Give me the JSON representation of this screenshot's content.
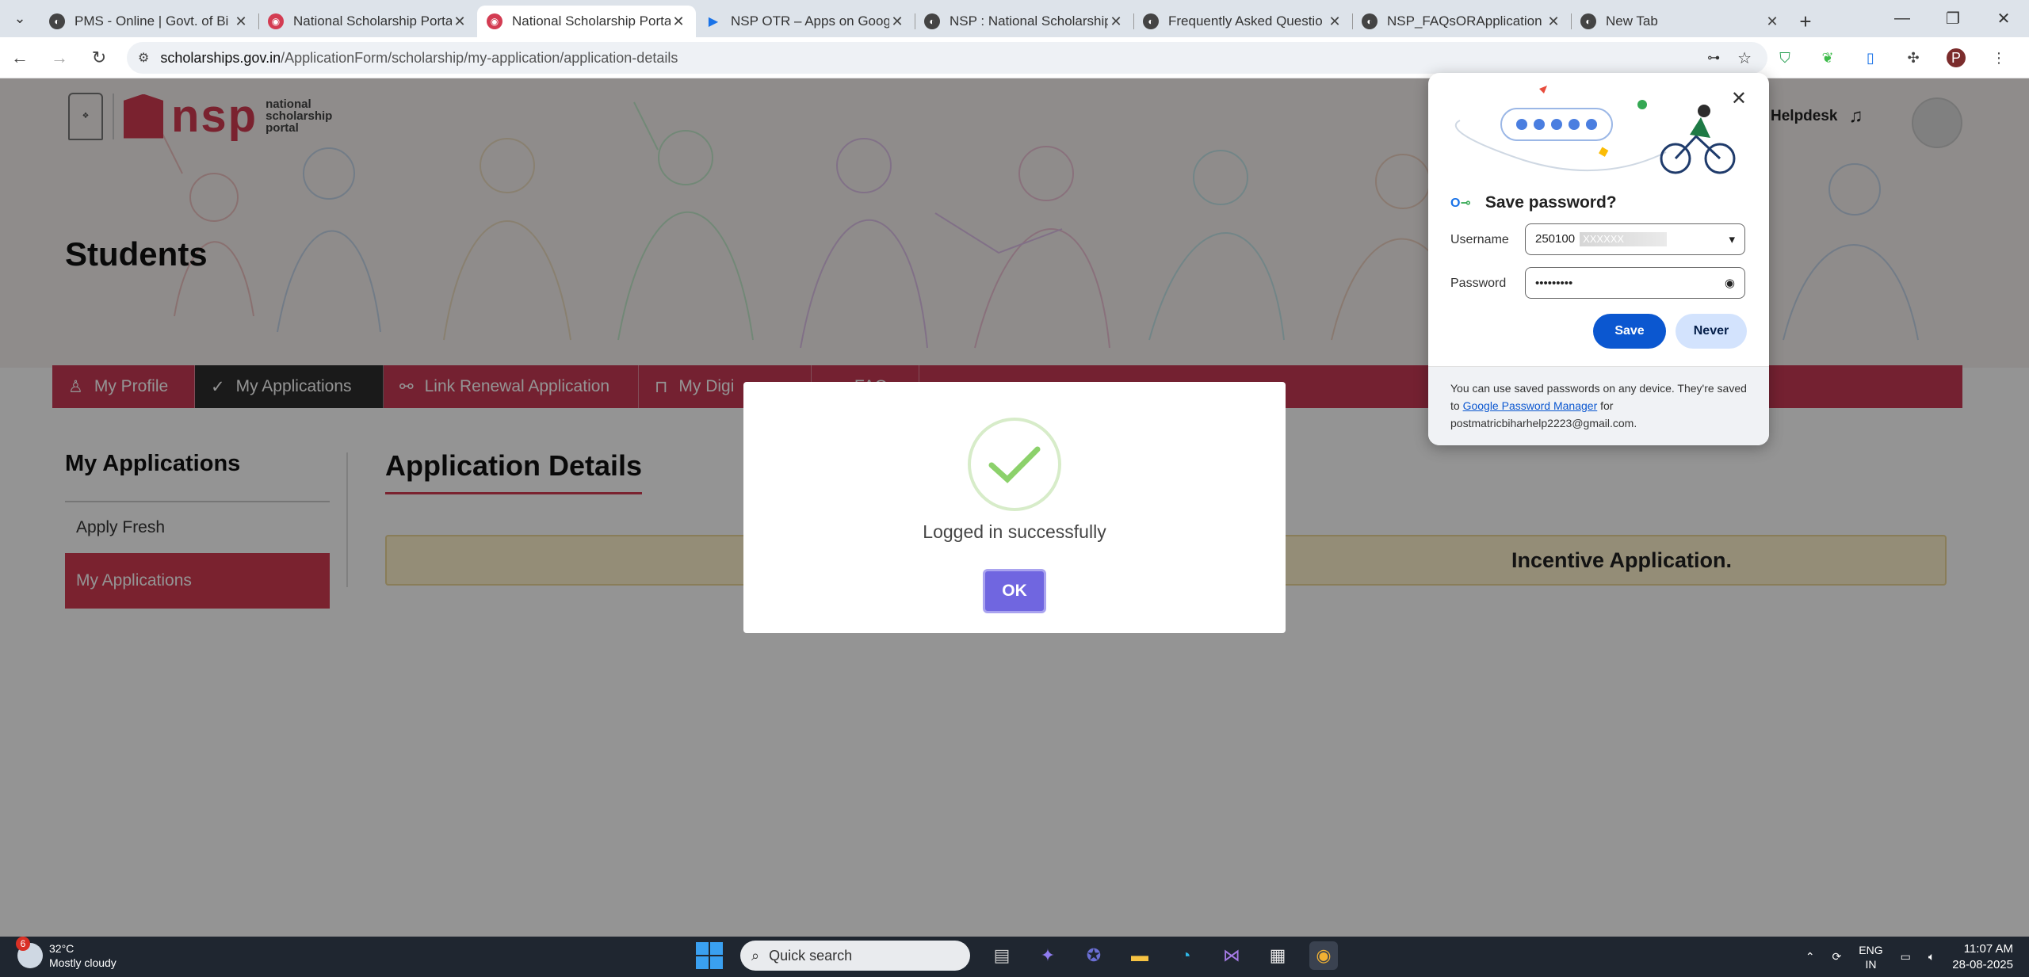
{
  "browser": {
    "tabs": [
      {
        "title": "PMS - Online | Govt. of Bi",
        "favicon": "globe-icon",
        "active": false
      },
      {
        "title": "National Scholarship Porta",
        "favicon": "nsp-icon",
        "active": false
      },
      {
        "title": "National Scholarship Porta",
        "favicon": "nsp-icon",
        "active": true
      },
      {
        "title": "NSP OTR – Apps on Goog",
        "favicon": "play-icon",
        "active": false
      },
      {
        "title": "NSP : National Scholarship",
        "favicon": "globe-icon",
        "active": false
      },
      {
        "title": "Frequently Asked Questio",
        "favicon": "globe-icon",
        "active": false
      },
      {
        "title": "NSP_FAQsORApplication",
        "favicon": "globe-icon",
        "active": false
      },
      {
        "title": "New Tab",
        "favicon": "chrome-icon",
        "active": false
      }
    ],
    "url_host": "scholarships.gov.in",
    "url_path": "/ApplicationForm/scholarship/my-application/application-details",
    "profile_initial": "P"
  },
  "header": {
    "logo_word": "nsp",
    "logo_sub_1": "national",
    "logo_sub_2": "scholarship",
    "logo_sub_3": "portal",
    "helpdesk": "Helpdesk",
    "page_heading": "Students"
  },
  "navbar": {
    "items": [
      {
        "label": "My Profile",
        "icon": "user-icon"
      },
      {
        "label": "My Applications",
        "icon": "check-circle-icon"
      },
      {
        "label": "Link Renewal Application",
        "icon": "link-icon"
      },
      {
        "label": "My Digi",
        "icon": "lock-icon"
      },
      {
        "label": "FAQ",
        "icon": "doc-icon"
      }
    ]
  },
  "sidebar": {
    "title": "My Applications",
    "items": [
      {
        "label": "Apply Fresh"
      },
      {
        "label": "My Applications"
      }
    ]
  },
  "main": {
    "title": "Application Details",
    "notice": "Incentive Application."
  },
  "modal": {
    "message": "Logged in successfully",
    "ok_label": "OK"
  },
  "password_bubble": {
    "title": "Save password?",
    "username_label": "Username",
    "username_value": "250100",
    "username_masked": "XXXXXX",
    "password_label": "Password",
    "password_value": "•••••••••",
    "save_label": "Save",
    "never_label": "Never",
    "footer_prefix": "You can use saved passwords on any device. They're saved to ",
    "footer_link": "Google Password Manager",
    "footer_suffix": " for",
    "footer_email": "postmatricbiharhelp2223@gmail.com."
  },
  "taskbar": {
    "weather_badge": "6",
    "temperature": "32°C",
    "condition": "Mostly cloudy",
    "search_placeholder": "Quick search",
    "lang_1": "ENG",
    "lang_2": "IN",
    "time": "11:07 AM",
    "date": "28-08-2025"
  },
  "colors": {
    "brand": "#d33c52",
    "ok_button": "#7066e0",
    "save_button": "#0b57d0"
  }
}
